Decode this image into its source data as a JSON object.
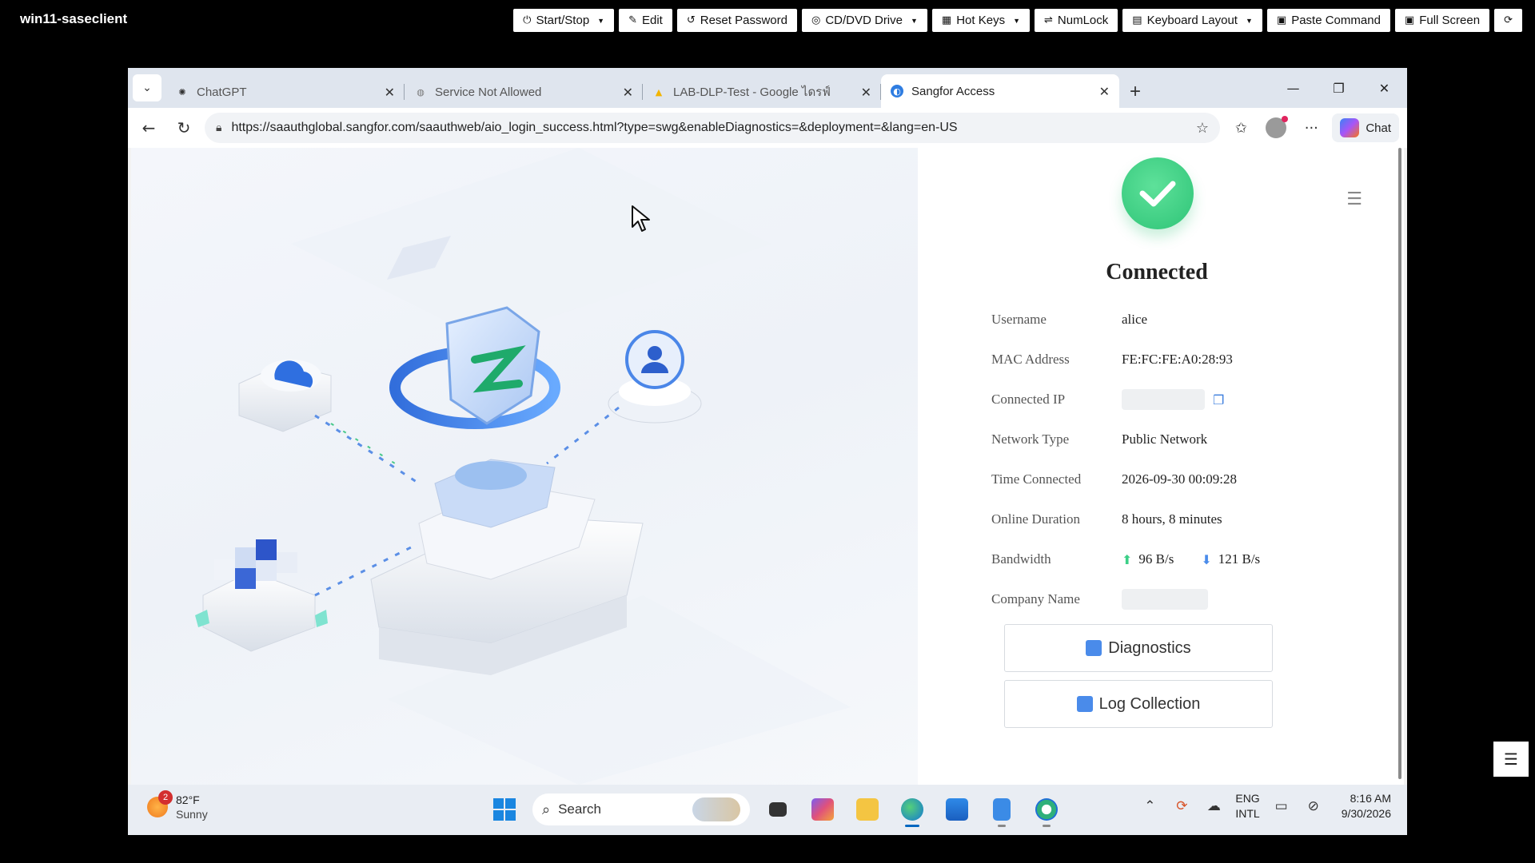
{
  "console": {
    "title": "win11-saseclient",
    "buttons": [
      {
        "label": "Start/Stop",
        "icon": "⏻",
        "dropdown": true
      },
      {
        "label": "Edit",
        "icon": "✎",
        "dropdown": false
      },
      {
        "label": "Reset Password",
        "icon": "↺",
        "dropdown": false
      },
      {
        "label": "CD/DVD Drive",
        "icon": "◎",
        "dropdown": true
      },
      {
        "label": "Hot Keys",
        "icon": "▦",
        "dropdown": true
      },
      {
        "label": "NumLock",
        "icon": "⇌",
        "dropdown": false
      },
      {
        "label": "Keyboard Layout",
        "icon": "▤",
        "dropdown": true
      },
      {
        "label": "Paste Command",
        "icon": "▣",
        "dropdown": false
      },
      {
        "label": "Full Screen",
        "icon": "▣",
        "dropdown": false
      }
    ],
    "refresh_icon": "⟳"
  },
  "browser": {
    "tabs": [
      {
        "label": "ChatGPT",
        "icon": "chatgpt-icon",
        "active": false
      },
      {
        "label": "Service Not Allowed",
        "icon": "globe-icon",
        "active": false
      },
      {
        "label": "LAB-DLP-Test - Google ไดรฟ์",
        "icon": "google-drive-icon",
        "active": false
      },
      {
        "label": "Sangfor Access",
        "icon": "sangfor-icon",
        "active": true
      }
    ],
    "url": "https://saauthglobal.sangfor.com/saauthweb/aio_login_success.html?type=swg&enableDiagnostics=&deployment=&lang=en-US",
    "chat_label": "Chat"
  },
  "panel": {
    "status": "Connected",
    "rows": [
      {
        "key": "Username",
        "value": "alice"
      },
      {
        "key": "MAC Address",
        "value": "FE:FC:FE:A0:28:93"
      },
      {
        "key": "Connected IP",
        "value": ""
      },
      {
        "key": "Network Type",
        "value": "Public Network"
      },
      {
        "key": "Time Connected",
        "value": "2026-09-30 00:09:28"
      },
      {
        "key": "Online Duration",
        "value": "8 hours, 8 minutes"
      },
      {
        "key": "Bandwidth",
        "value": ""
      },
      {
        "key": "Company Name",
        "value": ""
      }
    ],
    "bandwidth_up": "96 B/s",
    "bandwidth_down": "121 B/s",
    "buttons": {
      "diagnostics": "Diagnostics",
      "log_collection": "Log Collection"
    },
    "colors": {
      "success": "#2ec477",
      "accent": "#4a8bea"
    }
  },
  "taskbar": {
    "weather_badge": "2",
    "temperature": "82°F",
    "condition": "Sunny",
    "search_placeholder": "Search",
    "lang_top": "ENG",
    "lang_bottom": "INTL",
    "time": "8:16 AM",
    "date": "9/30/2026"
  }
}
